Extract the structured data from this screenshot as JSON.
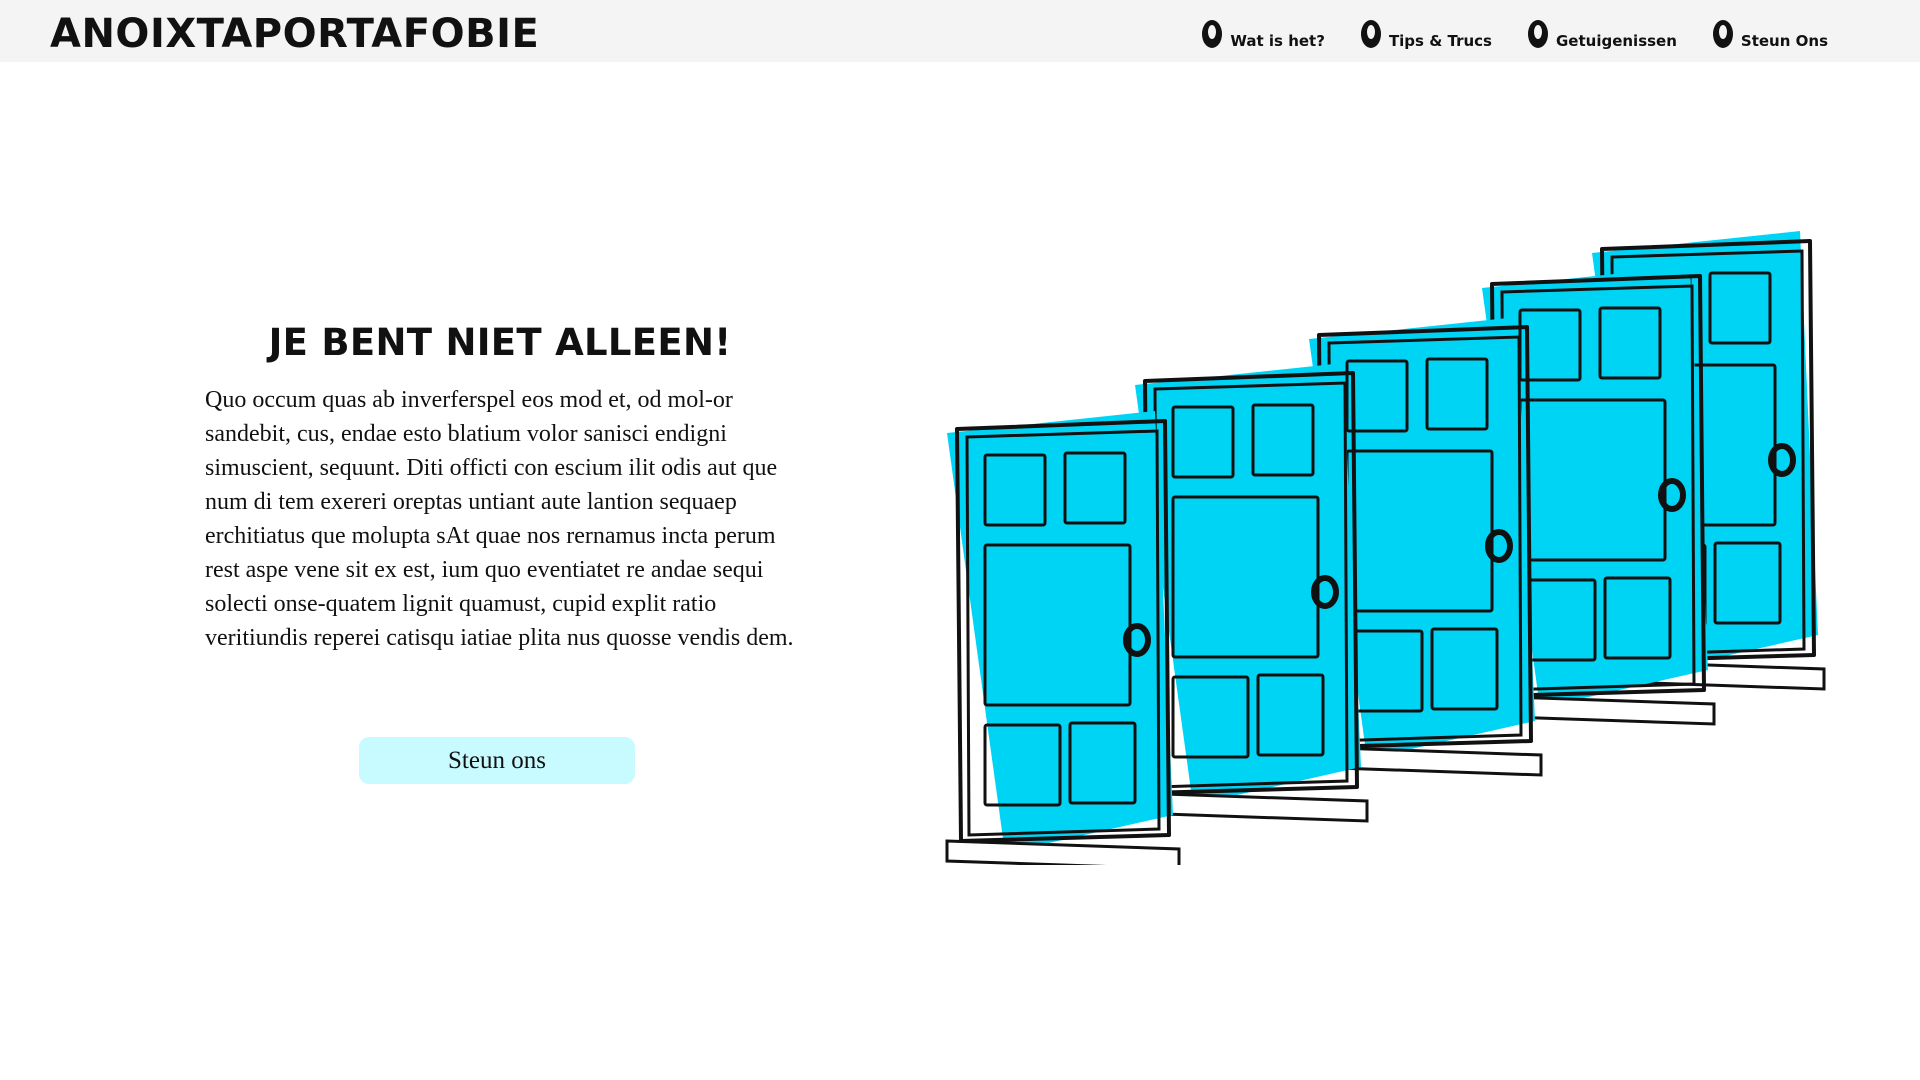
{
  "header": {
    "logo": "ANOIXTAPORTAFOBIE",
    "nav": [
      {
        "label": "Wat is het?",
        "icon": "door-knob-icon"
      },
      {
        "label": "Tips & Trucs",
        "icon": "door-knob-icon"
      },
      {
        "label": "Getuigenissen",
        "icon": "door-knob-icon"
      },
      {
        "label": "Steun Ons",
        "icon": "door-knob-icon"
      }
    ]
  },
  "hero": {
    "title": "JE BENT NIET ALLEEN!",
    "body": "Quo occum quas ab inverferspel eos mod et, od mol-or sandebit, cus, endae esto blatium volor sanisci endigni simuscient, sequunt. Diti officti con escium ilit odis aut que num di tem exereri oreptas untiant aute lantion sequaep erchitiatus que molupta sAt quae nos rernamus incta perum rest aspe vene sit ex est, ium quo eventiatet re andae sequi solecti onse-quatem lignit quamust, cupid explit ratio veritiundis reperei catisqu iatiae plita nus quosse vendis dem.",
    "cta_label": "Steun ons",
    "illustration": "doors-illustration"
  },
  "colors": {
    "header_bg": "#f4f4f4",
    "accent_cyan": "#00d4f5",
    "button_bg": "#c7fbff",
    "ink": "#111111"
  }
}
